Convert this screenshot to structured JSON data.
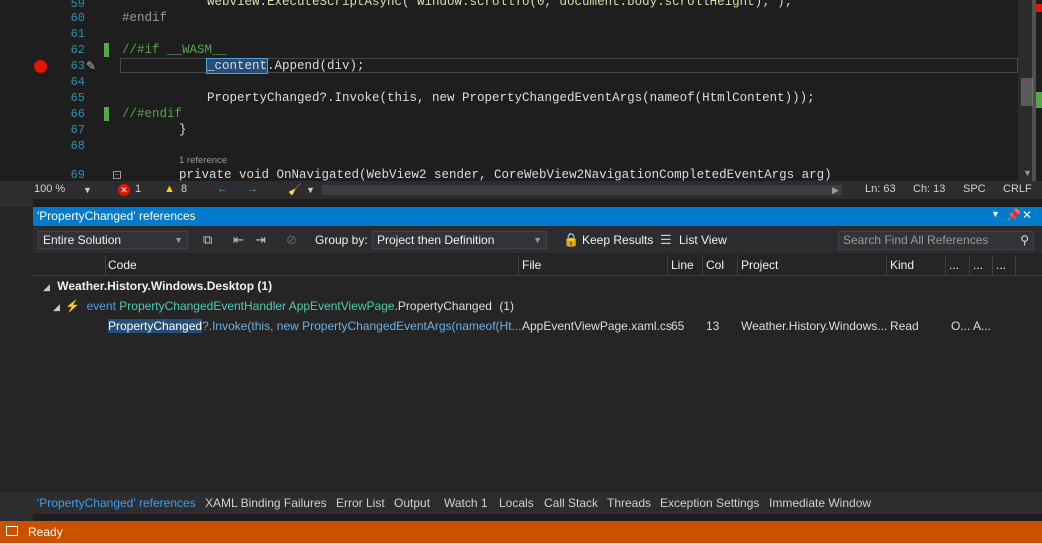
{
  "editor": {
    "lines": [
      {
        "num": "59",
        "text": "webview.ExecuteScriptAsync(\"window.scrollTo(0, document.body.scrollHeight);\");"
      },
      {
        "num": "60",
        "text": "#endif"
      },
      {
        "num": "61",
        "text": ""
      },
      {
        "num": "62",
        "text": "//#if __WASM__"
      },
      {
        "num": "63",
        "text_a": "_content",
        "text_b": ".Append(div);"
      },
      {
        "num": "64",
        "text": ""
      },
      {
        "num": "65",
        "text": "PropertyChanged?.Invoke(this, new PropertyChangedEventArgs(nameof(HtmlContent)));"
      },
      {
        "num": "66",
        "text": "//#endif"
      },
      {
        "num": "67",
        "text": "}"
      },
      {
        "num": "68",
        "text": ""
      },
      {
        "num": "69",
        "text": "private void OnNavigated(WebView2 sender, CoreWebView2NavigationCompletedEventArgs arg)"
      }
    ],
    "codelens": "1 reference"
  },
  "editor_status": {
    "zoom": "100 %",
    "errors": "1",
    "warnings": "8",
    "line": "Ln: 63",
    "col": "Ch: 13",
    "whitespace": "SPC",
    "line_ending": "CRLF"
  },
  "references": {
    "title": "'PropertyChanged' references",
    "scope": "Entire Solution",
    "group_by_label": "Group by:",
    "group_by_value": "Project then Definition",
    "keep_results": "Keep Results",
    "list_view": "List View",
    "search_placeholder": "Search Find All References",
    "columns": [
      "Code",
      "File",
      "Line",
      "Col",
      "Project",
      "Kind",
      "...",
      "...",
      "..."
    ],
    "group": "Weather.History.Windows.Desktop  (1)",
    "definition_kw": "event",
    "definition_text": "PropertyChangedEventHandler AppEventViewPage",
    "definition_member": ".PropertyChanged",
    "definition_count": "(1)",
    "result": {
      "code_sel": "PropertyChanged",
      "code_rest": "?.Invoke(this, new PropertyChangedEventArgs(nameof(Ht...",
      "file": "AppEventViewPage.xaml.cs",
      "line": "65",
      "col": "13",
      "project": "Weather.History.Windows...",
      "kind": "Read",
      "extra1": "O...",
      "extra2": "A..."
    }
  },
  "tabs": [
    "'PropertyChanged' references",
    "XAML Binding Failures",
    "Error List",
    "Output",
    "Watch 1",
    "Locals",
    "Call Stack",
    "Threads",
    "Exception Settings",
    "Immediate Window"
  ],
  "status": {
    "ready": "Ready"
  },
  "colors": {
    "accent": "#007acc",
    "statusbar": "#ca5100",
    "breakpoint": "#e51400"
  }
}
